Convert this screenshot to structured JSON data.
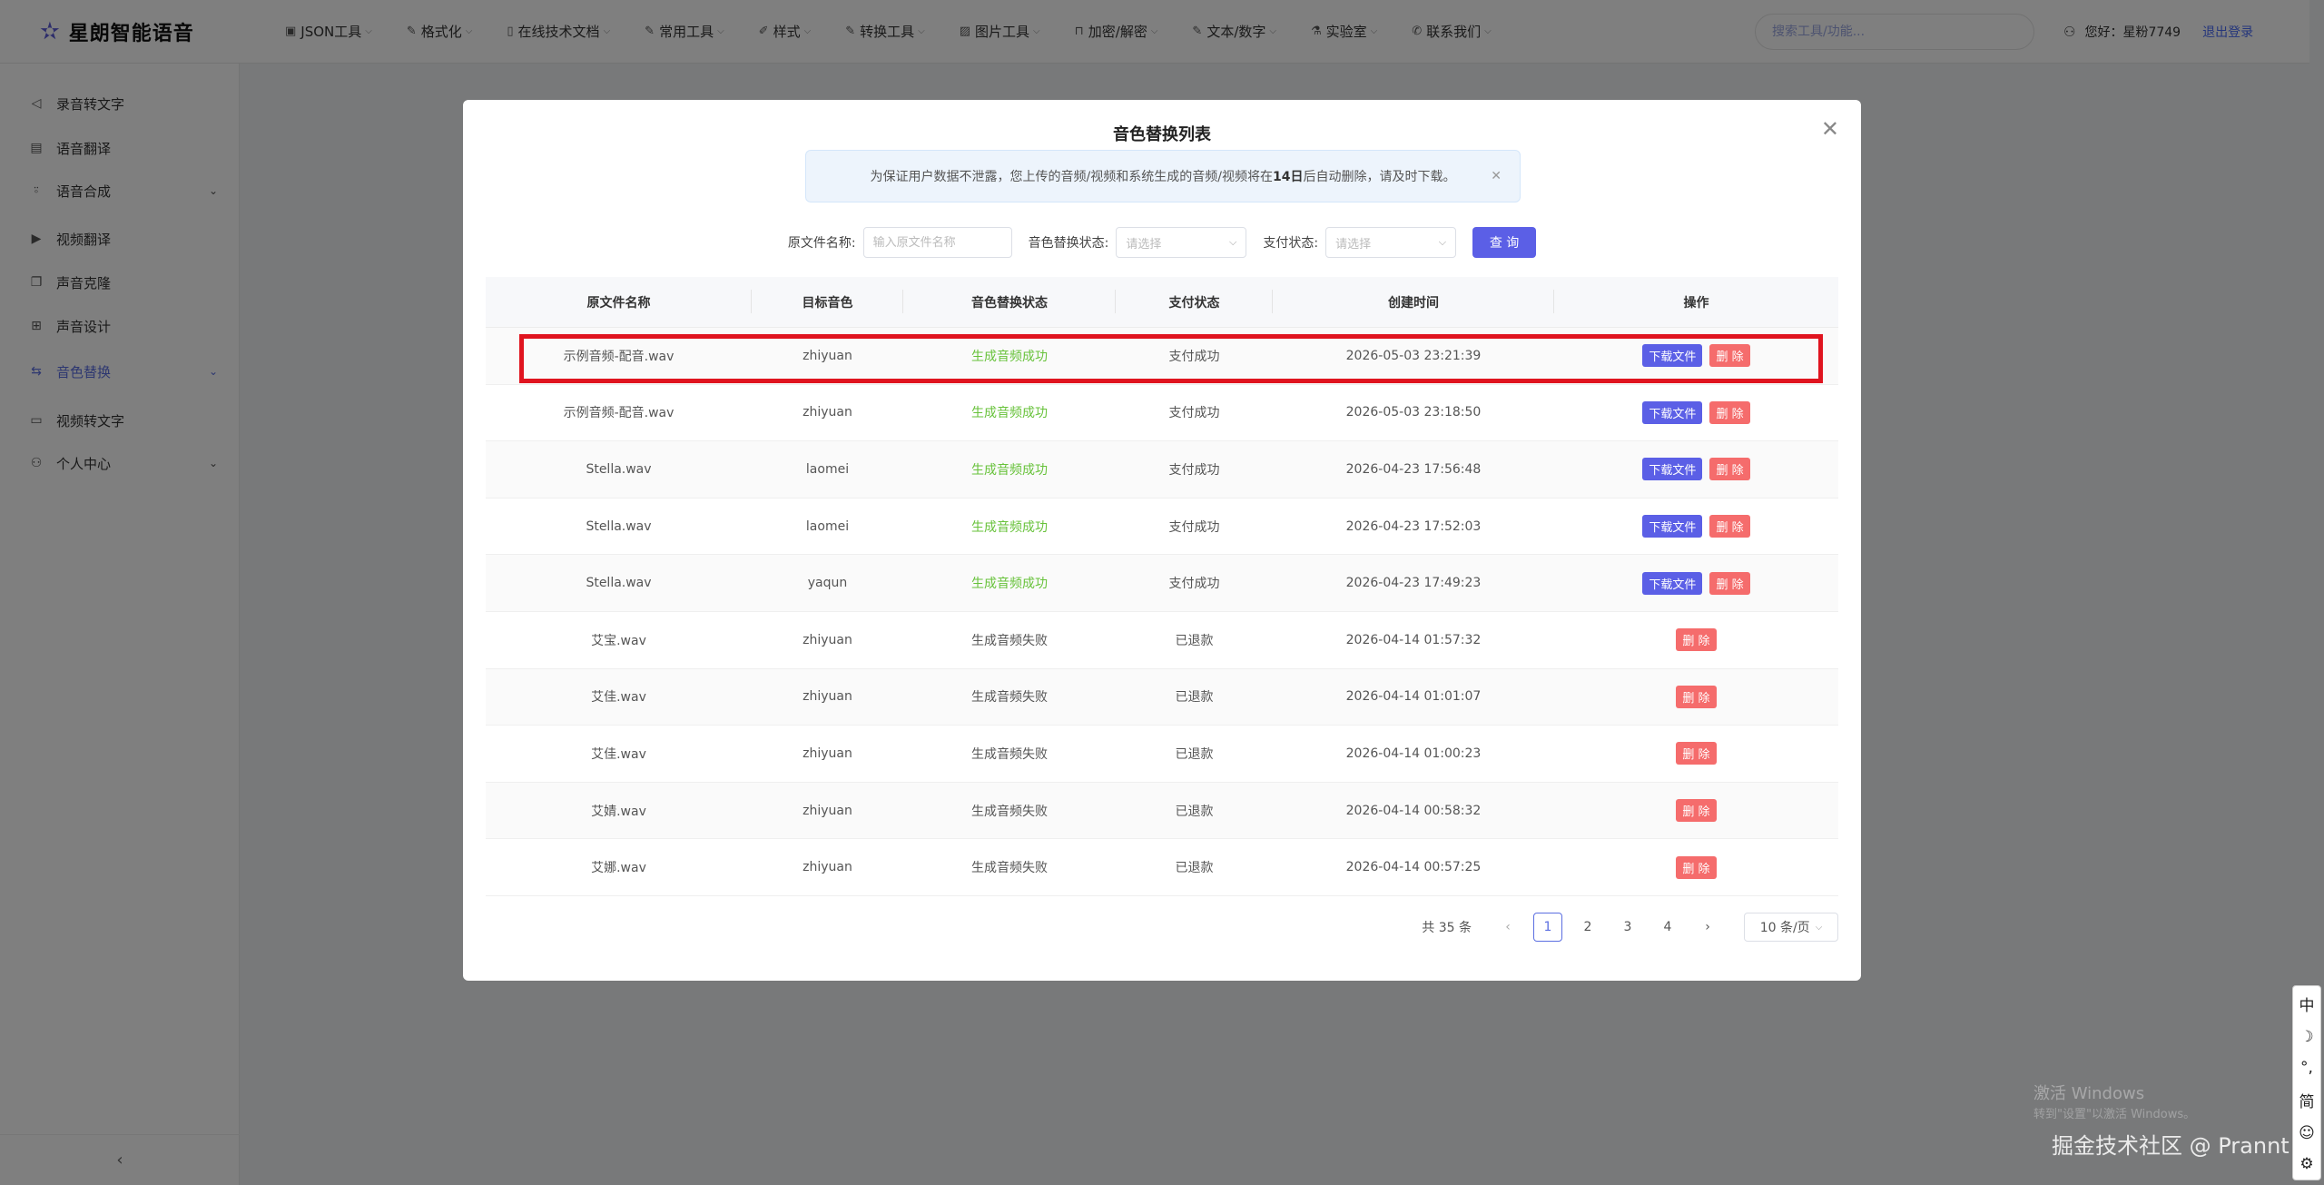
{
  "app": {
    "logo_icon": "star-logo-icon",
    "name": "星朗智能语音"
  },
  "menu": [
    {
      "label": "JSON工具",
      "icon": "terminal-icon"
    },
    {
      "label": "格式化",
      "icon": "edit-icon"
    },
    {
      "label": "在线技术文档",
      "icon": "document-icon"
    },
    {
      "label": "常用工具",
      "icon": "edit-icon"
    },
    {
      "label": "样式",
      "icon": "paint-icon"
    },
    {
      "label": "转换工具",
      "icon": "edit-icon"
    },
    {
      "label": "图片工具",
      "icon": "image-icon"
    },
    {
      "label": "加密/解密",
      "icon": "lock-icon"
    },
    {
      "label": "文本/数字",
      "icon": "edit-icon"
    },
    {
      "label": "实验室",
      "icon": "flask-icon"
    },
    {
      "label": "联系我们",
      "icon": "phone-icon"
    }
  ],
  "search": {
    "placeholder": "搜索工具/功能..."
  },
  "user": {
    "greeting": "您好：星粉7749",
    "logout": "退出登录"
  },
  "sidebar": [
    {
      "label": "录音转文字",
      "icon": "speaker-icon"
    },
    {
      "label": "语音翻译",
      "icon": "image-translate-icon"
    },
    {
      "label": "语音合成",
      "icon": "microphone-icon",
      "expandable": true
    },
    {
      "label": "视频翻译",
      "icon": "play-icon"
    },
    {
      "label": "声音克隆",
      "icon": "copy-icon"
    },
    {
      "label": "声音设计",
      "icon": "grid-icon"
    },
    {
      "label": "音色替换",
      "icon": "swap-icon",
      "expandable": true,
      "active": true
    },
    {
      "label": "视频转文字",
      "icon": "video-icon"
    },
    {
      "label": "个人中心",
      "icon": "user-icon",
      "expandable": true
    }
  ],
  "modal": {
    "title": "音色替换列表",
    "notice_prefix": "为保证用户数据不泄露，您上传的音频/视频和系统生成的音频/视频将在",
    "notice_bold": "14日",
    "notice_suffix": "后自动删除，请及时下载。",
    "filters": {
      "filename_label": "原文件名称:",
      "filename_placeholder": "输入原文件名称",
      "status_label": "音色替换状态:",
      "status_placeholder": "请选择",
      "pay_label": "支付状态:",
      "pay_placeholder": "请选择",
      "query": "查 询"
    },
    "columns": [
      "原文件名称",
      "目标音色",
      "音色替换状态",
      "支付状态",
      "创建时间",
      "操作"
    ],
    "download_label": "下载文件",
    "delete_label": "删 除",
    "rows": [
      {
        "file": "示例音频-配音.wav",
        "voice": "zhiyuan",
        "status": "生成音频成功",
        "pay": "支付成功",
        "time": "2026-05-03 23:21:39",
        "ok": true
      },
      {
        "file": "示例音频-配音.wav",
        "voice": "zhiyuan",
        "status": "生成音频成功",
        "pay": "支付成功",
        "time": "2026-05-03 23:18:50",
        "ok": true
      },
      {
        "file": "Stella.wav",
        "voice": "laomei",
        "status": "生成音频成功",
        "pay": "支付成功",
        "time": "2026-04-23 17:56:48",
        "ok": true
      },
      {
        "file": "Stella.wav",
        "voice": "laomei",
        "status": "生成音频成功",
        "pay": "支付成功",
        "time": "2026-04-23 17:52:03",
        "ok": true
      },
      {
        "file": "Stella.wav",
        "voice": "yaqun",
        "status": "生成音频成功",
        "pay": "支付成功",
        "time": "2026-04-23 17:49:23",
        "ok": true
      },
      {
        "file": "艾宝.wav",
        "voice": "zhiyuan",
        "status": "生成音频失败",
        "pay": "已退款",
        "time": "2026-04-14 01:57:32",
        "ok": false
      },
      {
        "file": "艾佳.wav",
        "voice": "zhiyuan",
        "status": "生成音频失败",
        "pay": "已退款",
        "time": "2026-04-14 01:01:07",
        "ok": false
      },
      {
        "file": "艾佳.wav",
        "voice": "zhiyuan",
        "status": "生成音频失败",
        "pay": "已退款",
        "time": "2026-04-14 01:00:23",
        "ok": false
      },
      {
        "file": "艾婧.wav",
        "voice": "zhiyuan",
        "status": "生成音频失败",
        "pay": "已退款",
        "time": "2026-04-14 00:58:32",
        "ok": false
      },
      {
        "file": "艾娜.wav",
        "voice": "zhiyuan",
        "status": "生成音频失败",
        "pay": "已退款",
        "time": "2026-04-14 00:57:25",
        "ok": false
      }
    ],
    "pagination": {
      "total": "共 35 条",
      "pages": [
        "1",
        "2",
        "3",
        "4"
      ],
      "current": "1",
      "page_size": "10 条/页"
    }
  },
  "ime": [
    "中",
    "☽",
    "°,",
    "简",
    "☺",
    "⚙"
  ],
  "watermark": {
    "activate": "激活 Windows",
    "activate_sub": "转到\"设置\"以激活 Windows。",
    "credit": "掘金技术社区 @ Prannt"
  }
}
